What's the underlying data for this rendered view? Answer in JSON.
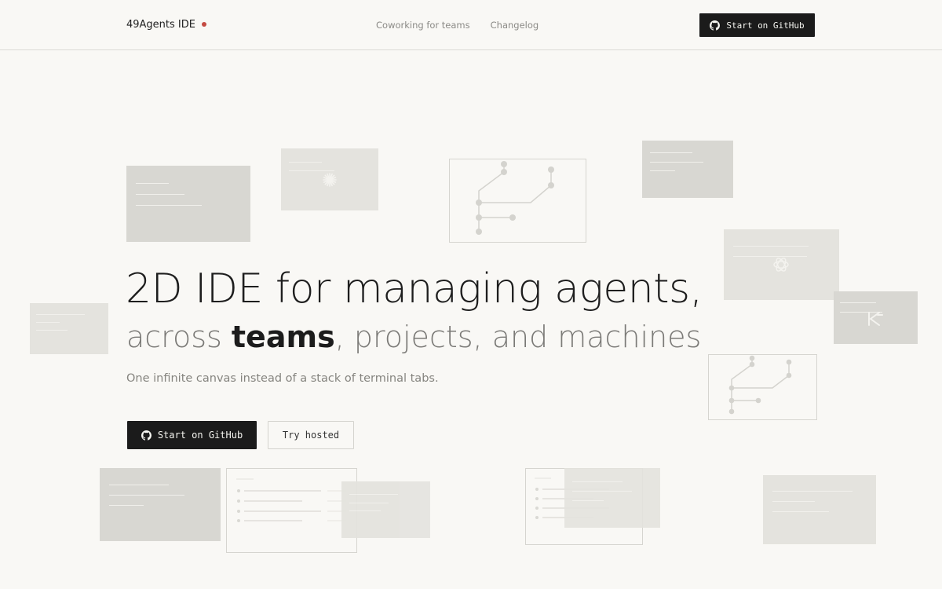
{
  "header": {
    "brand": "49Agents IDE",
    "nav": [
      "Coworking for teams",
      "Changelog"
    ],
    "cta_label": "Start on GitHub"
  },
  "hero": {
    "title": "2D IDE for managing agents,",
    "subtitle_prefix": "across ",
    "subtitle_bold": "teams",
    "subtitle_suffix": ", projects, and machines",
    "description": "One infinite canvas instead of a stack of terminal tabs.",
    "primary_cta": "Start on GitHub",
    "secondary_cta": "Try hosted"
  },
  "colors": {
    "background": "#f9f8f5",
    "accent_dot": "#c44a42",
    "button_dark": "#1b1b1b"
  },
  "icons": [
    "github-icon",
    "claude-starburst-icon",
    "openai-icon",
    "k-logo-icon"
  ]
}
